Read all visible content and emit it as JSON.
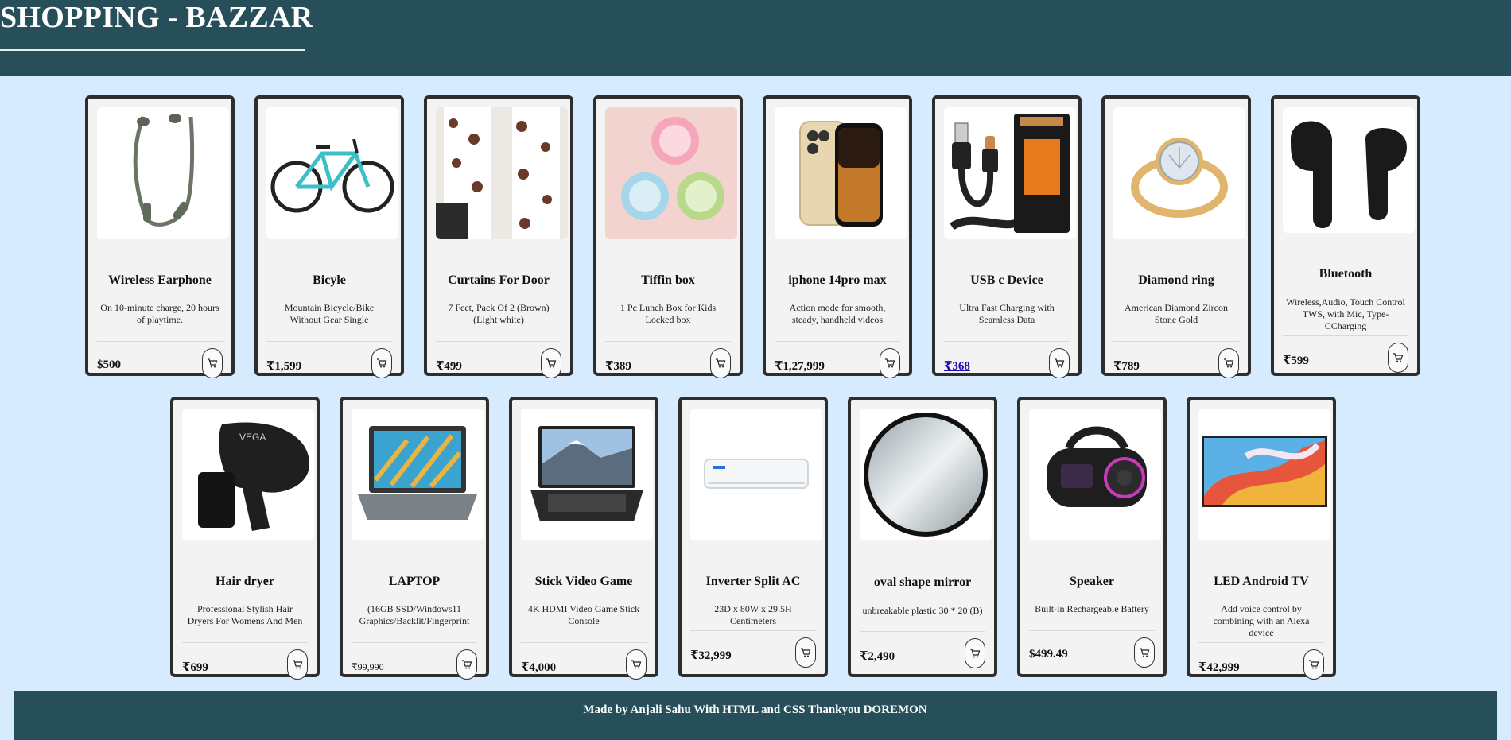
{
  "header": {
    "title": "SHOPPING - BAZZAR"
  },
  "products": [
    {
      "title": "Wireless Earphone",
      "desc": "On 10-minute charge, 20 hours of playtime.",
      "price": "$500",
      "icon": "earphone-image"
    },
    {
      "title": "Bicyle",
      "desc": "Mountain Bicycle/Bike Without Gear Single",
      "price": "₹1,599",
      "icon": "bicycle-image"
    },
    {
      "title": "Curtains For Door",
      "desc": "7 Feet, Pack Of 2 (Brown) (Light white)",
      "price": "₹499",
      "icon": "curtains-image"
    },
    {
      "title": "Tiffin box",
      "desc": "1 Pc Lunch Box for Kids Locked box",
      "price": "₹389",
      "icon": "tiffin-box-image"
    },
    {
      "title": "iphone 14pro max",
      "desc": "Action mode for smooth, steady, handheld videos",
      "price": "₹1,27,999",
      "icon": "iphone-image"
    },
    {
      "title": "USB c Device",
      "desc": "Ultra Fast Charging with Seamless Data",
      "price": "₹368",
      "icon": "usb-cable-image"
    },
    {
      "title": "Diamond ring",
      "desc": "American Diamond Zircon Stone Gold",
      "price": "₹789",
      "icon": "ring-image"
    },
    {
      "title": "Bluetooth",
      "desc": "Wireless,Audio, Touch Control TWS, with Mic, Type-CCharging",
      "price": "₹599",
      "icon": "earbuds-image"
    },
    {
      "title": "Hair dryer",
      "desc": "Professional Stylish Hair Dryers For Womens And Men",
      "price": "₹699",
      "icon": "hair-dryer-image"
    },
    {
      "title": "LAPTOP",
      "desc": "(16GB SSD/Windows11 Graphics/Backlit/Fingerprint",
      "price": "₹99,990",
      "icon": "laptop-image"
    },
    {
      "title": "Stick Video Game",
      "desc": "4K HDMI Video Game Stick Console",
      "price": "₹4,000",
      "icon": "notebook-image"
    },
    {
      "title": "Inverter Split AC",
      "desc": "23D x 80W x 29.5H Centimeters",
      "price": "₹32,999",
      "icon": "air-conditioner-image"
    },
    {
      "title": "oval shape mirror",
      "desc": "unbreakable plastic 30 * 20 (B)",
      "price": "₹2,490",
      "icon": "mirror-image"
    },
    {
      "title": "Speaker",
      "desc": "Built-in Rechargeable Battery",
      "price": "$499.49",
      "icon": "speaker-image"
    },
    {
      "title": "LED Android TV",
      "desc": "Add voice control by combining with an Alexa device",
      "price": "₹42,999",
      "icon": "tv-image"
    }
  ],
  "cart_icon": "cart-icon",
  "footer": {
    "text": "Made by Anjali Sahu With HTML and CSS Thankyou DOREMON"
  }
}
